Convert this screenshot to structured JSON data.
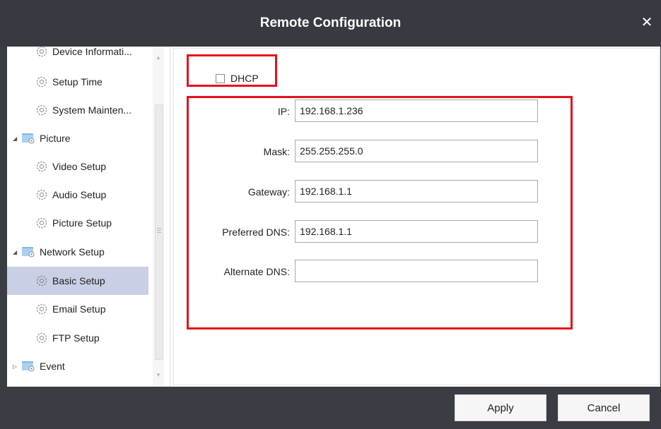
{
  "window": {
    "title": "Remote Configuration",
    "close_glyph": "✕"
  },
  "sidebar": {
    "items": [
      {
        "label": "Device Informati...",
        "type": "leaf",
        "icon": "gear-icon"
      },
      {
        "label": "Setup Time",
        "type": "leaf",
        "icon": "gear-icon"
      },
      {
        "label": "System Mainten...",
        "type": "leaf",
        "icon": "gear-icon"
      },
      {
        "label": "Picture",
        "type": "folder",
        "expanded": true,
        "icon": "folder-icon"
      },
      {
        "label": "Video Setup",
        "type": "leaf",
        "icon": "gear-icon"
      },
      {
        "label": "Audio Setup",
        "type": "leaf",
        "icon": "gear-icon"
      },
      {
        "label": "Picture Setup",
        "type": "leaf",
        "icon": "gear-icon"
      },
      {
        "label": "Network Setup",
        "type": "folder",
        "expanded": true,
        "icon": "folder-icon"
      },
      {
        "label": "Basic Setup",
        "type": "leaf",
        "icon": "gear-icon",
        "selected": true
      },
      {
        "label": "Email Setup",
        "type": "leaf",
        "icon": "gear-icon"
      },
      {
        "label": "FTP Setup",
        "type": "leaf",
        "icon": "gear-icon"
      },
      {
        "label": "Event",
        "type": "folder",
        "expanded": false,
        "icon": "folder-icon"
      }
    ]
  },
  "form": {
    "dhcp": {
      "label": "DHCP",
      "checked": false
    },
    "ip": {
      "label": "IP:",
      "value": "192.168.1.236"
    },
    "mask": {
      "label": "Mask:",
      "value": "255.255.255.0"
    },
    "gateway": {
      "label": "Gateway:",
      "value": "192.168.1.1"
    },
    "preferred_dns": {
      "label": "Preferred DNS:",
      "value": "192.168.1.1"
    },
    "alternate_dns": {
      "label": "Alternate DNS:",
      "value": ""
    }
  },
  "footer": {
    "apply_label": "Apply",
    "cancel_label": "Cancel"
  },
  "colors": {
    "titlebar": "#373a41",
    "highlight": "#e3121b",
    "selected": "#c9cfe4"
  }
}
